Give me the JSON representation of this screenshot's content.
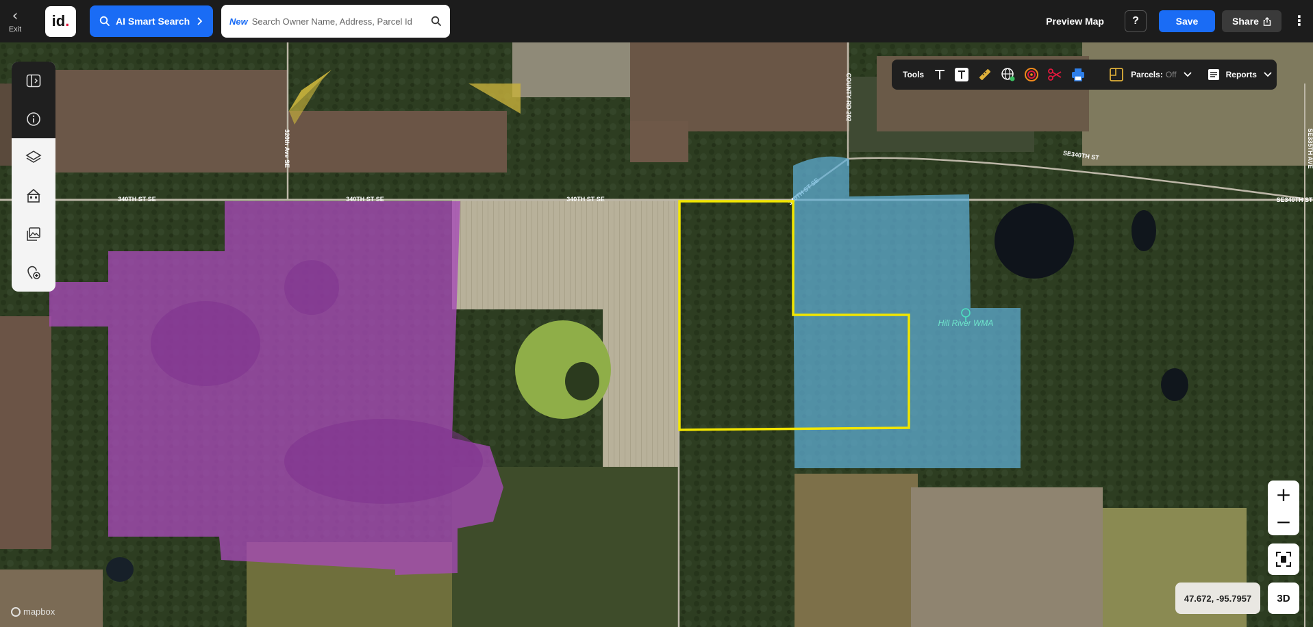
{
  "topbar": {
    "exit_label": "Exit",
    "logo_text": "id",
    "ai_search_label": "AI Smart Search",
    "search_new_tag": "New",
    "search_placeholder": "Search Owner Name, Address, Parcel Id",
    "preview_map_label": "Preview Map",
    "help_label": "?",
    "save_label": "Save",
    "share_label": "Share",
    "accent_color": "#1a6cf5"
  },
  "tools": {
    "label": "Tools",
    "parcels_label": "Parcels:",
    "parcels_state": "Off",
    "reports_label": "Reports"
  },
  "map": {
    "road_labels": {
      "r1": "340TH ST SE",
      "r2": "340TH ST SE",
      "r3": "340TH ST SE",
      "r4": "340TH ST SE",
      "r5": "SE340TH ST",
      "r6": "SE340TH ST",
      "r7": "320th Ave SE",
      "r8": "COUNTY RD 202",
      "r9": "SE335TH AVE"
    },
    "place_label": "Hill River WMA",
    "coords": "47.672, -95.7957",
    "three_d_label": "3D",
    "attribution": "mapbox",
    "highlight_colors": {
      "selection": "#f2e600",
      "purple": "#a64ab7",
      "blue": "#5fb0d8",
      "yellow": "#c8b23c"
    }
  }
}
